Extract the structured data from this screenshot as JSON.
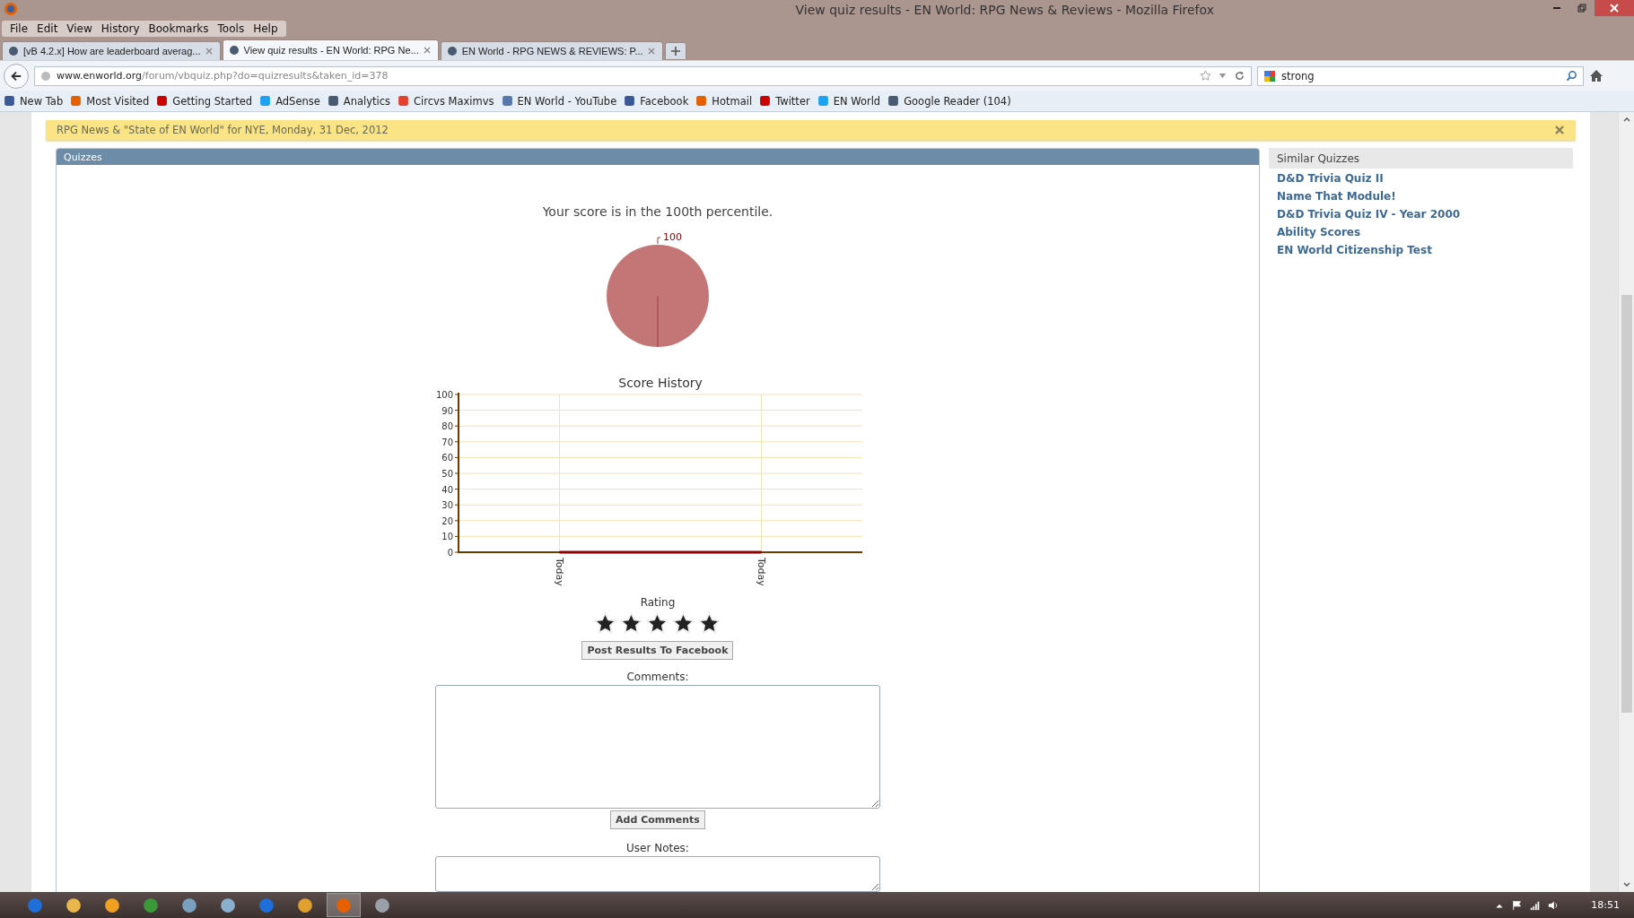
{
  "window": {
    "title": "View quiz results - EN World: RPG News & Reviews - Mozilla Firefox"
  },
  "menu": [
    "File",
    "Edit",
    "View",
    "History",
    "Bookmarks",
    "Tools",
    "Help"
  ],
  "tabs": [
    {
      "label": "[vB 4.2.x] How are leaderboard averag...",
      "selected": false
    },
    {
      "label": "View quiz results - EN World: RPG Ne...",
      "selected": true
    },
    {
      "label": "EN World - RPG NEWS & REVIEWS: P...",
      "selected": false
    }
  ],
  "address_bar": {
    "host": "www.enworld.org",
    "path": "/forum/vbquiz.php?do=quizresults&taken_id=378"
  },
  "search": {
    "value": "strong"
  },
  "bookmarks": [
    "New Tab",
    "Most Visited",
    "Getting Started",
    "AdSense",
    "Analytics",
    "Circvs Maximvs",
    "EN World - YouTube",
    "Facebook",
    "Hotmail",
    "Twitter",
    "EN World",
    "Google Reader (104)"
  ],
  "notice": {
    "text": "RPG News & \"State of EN World\" for NYE, Monday, 31 Dec, 2012"
  },
  "panel": {
    "title": "Quizzes",
    "percentile_text": "Your score is in the 100th percentile.",
    "pie": {
      "chart_data": {
        "type": "pie",
        "values": [
          100
        ],
        "data_labels": true
      }
    },
    "history": {
      "chart_data": {
        "type": "line",
        "title": "Score History",
        "categories": [
          "Today",
          "Today"
        ],
        "grid": true,
        "series": [
          {
            "color": "#8b0000",
            "values": [
              0,
              0
            ]
          }
        ],
        "ylim": [
          0,
          100
        ],
        "yticks": [
          0,
          10,
          20,
          30,
          40,
          50,
          60,
          70,
          80,
          90,
          100
        ]
      }
    },
    "rating": {
      "label": "Rating",
      "stars": 5
    },
    "post_button": "Post Results To Facebook",
    "comments_label": "Comments:",
    "add_button": "Add Comments",
    "notes_label": "User Notes:"
  },
  "sidebar": {
    "title": "Similar Quizzes",
    "items": [
      "D&D Trivia Quiz II",
      "Name That Module!",
      "D&D Trivia Quiz IV - Year 2000",
      "Ability Scores",
      "EN World Citizenship Test"
    ]
  },
  "taskbar": {
    "clock": "18:51"
  }
}
